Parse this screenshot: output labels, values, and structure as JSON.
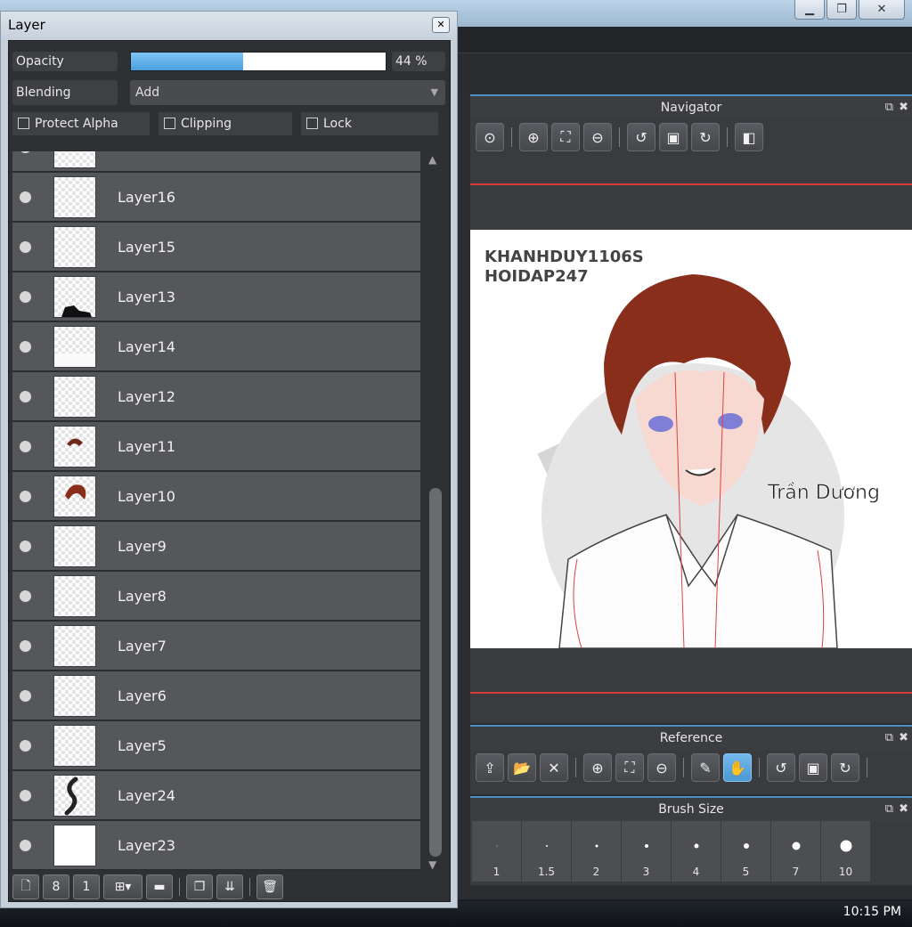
{
  "layer_panel": {
    "title": "Layer",
    "opacity_label": "Opacity",
    "opacity_value": "44 %",
    "opacity_fraction": 0.44,
    "blending_label": "Blending",
    "blending_value": "Add",
    "protect_alpha": "Protect Alpha",
    "clipping": "Clipping",
    "lock": "Lock",
    "layers": [
      {
        "name": "Layer16"
      },
      {
        "name": "Layer15"
      },
      {
        "name": "Layer13"
      },
      {
        "name": "Layer14"
      },
      {
        "name": "Layer12"
      },
      {
        "name": "Layer11"
      },
      {
        "name": "Layer10"
      },
      {
        "name": "Layer9"
      },
      {
        "name": "Layer8"
      },
      {
        "name": "Layer7"
      },
      {
        "name": "Layer6"
      },
      {
        "name": "Layer5"
      },
      {
        "name": "Layer24"
      },
      {
        "name": "Layer23"
      }
    ]
  },
  "navigator": {
    "title": "Navigator",
    "canvas_text_1": "KHANHDUY1106S",
    "canvas_text_2": "HOIDAP247",
    "canvas_signature": "Trần Dương"
  },
  "reference": {
    "title": "Reference"
  },
  "brush_size": {
    "title": "Brush Size",
    "sizes": [
      "1",
      "1.5",
      "2",
      "3",
      "4",
      "5",
      "7",
      "10"
    ]
  },
  "taskbar": {
    "clock": "10:15 PM"
  },
  "colors": {
    "accent": "#4d8fc4",
    "opacity_fill": "#5aaae6",
    "active_tool": "#5aa8e0",
    "guide_red": "#d63a3a"
  }
}
